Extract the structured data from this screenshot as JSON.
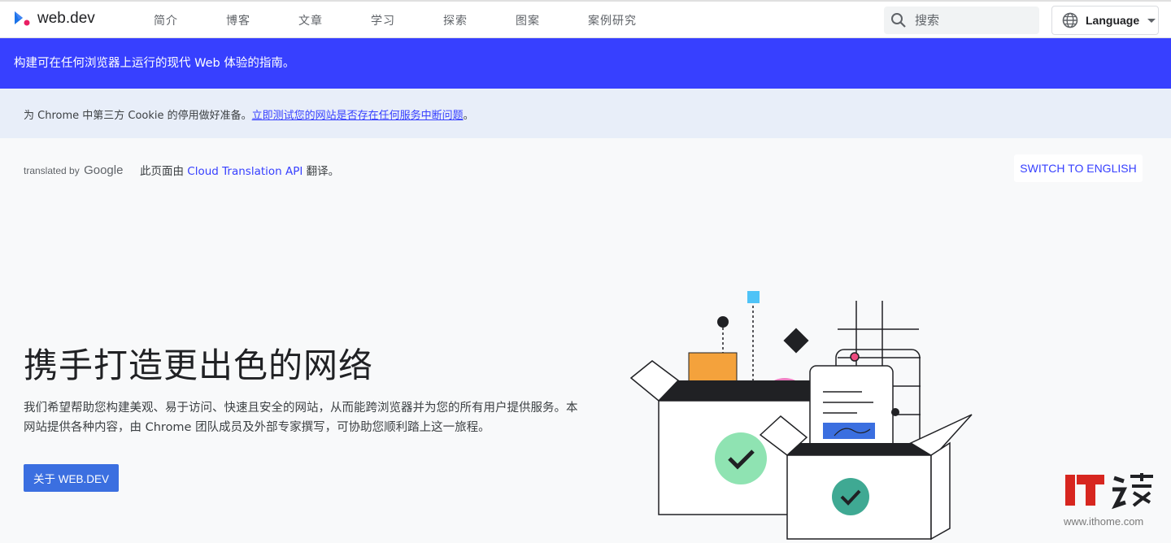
{
  "header": {
    "logo_text": "web.dev",
    "nav": [
      "简介",
      "博客",
      "文章",
      "学习",
      "探索",
      "图案",
      "案例研究"
    ],
    "search_placeholder": "搜索",
    "language_label": "Language"
  },
  "tagline": "构建可在任何浏览器上运行的现代 Web 体验的指南。",
  "notice": {
    "text": "为 Chrome 中第三方 Cookie 的停用做好准备。",
    "link": "立即测试您的网站是否存在任何服务中断问题",
    "suffix": "。"
  },
  "translation": {
    "by_prefix": "translated by",
    "by_brand": "Google",
    "info_prefix": "此页面由",
    "info_link": "Cloud Translation API",
    "info_suffix": "翻译。",
    "switch_label": "SWITCH TO ENGLISH"
  },
  "hero": {
    "title": "携手打造更出色的网络",
    "description": "我们希望帮助您构建美观、易于访问、快速且安全的网站，从而能跨浏览器并为您的所有用户提供服务。本网站提供各种内容，由 Chrome 团队成员及外部专家撰写，可协助您顺利踏上这一旅程。",
    "button_label": "关于 WEB.DEV"
  },
  "watermark": {
    "url": "www.ithome.com"
  },
  "colors": {
    "accent": "#3740ff",
    "button": "#3b6fe0",
    "notice_bg": "#e8eef9",
    "page_bg": "#f8f9fa"
  },
  "icons": {
    "logo": "webdev-chevron-logo",
    "search": "search-icon",
    "language": "globe-icon"
  }
}
